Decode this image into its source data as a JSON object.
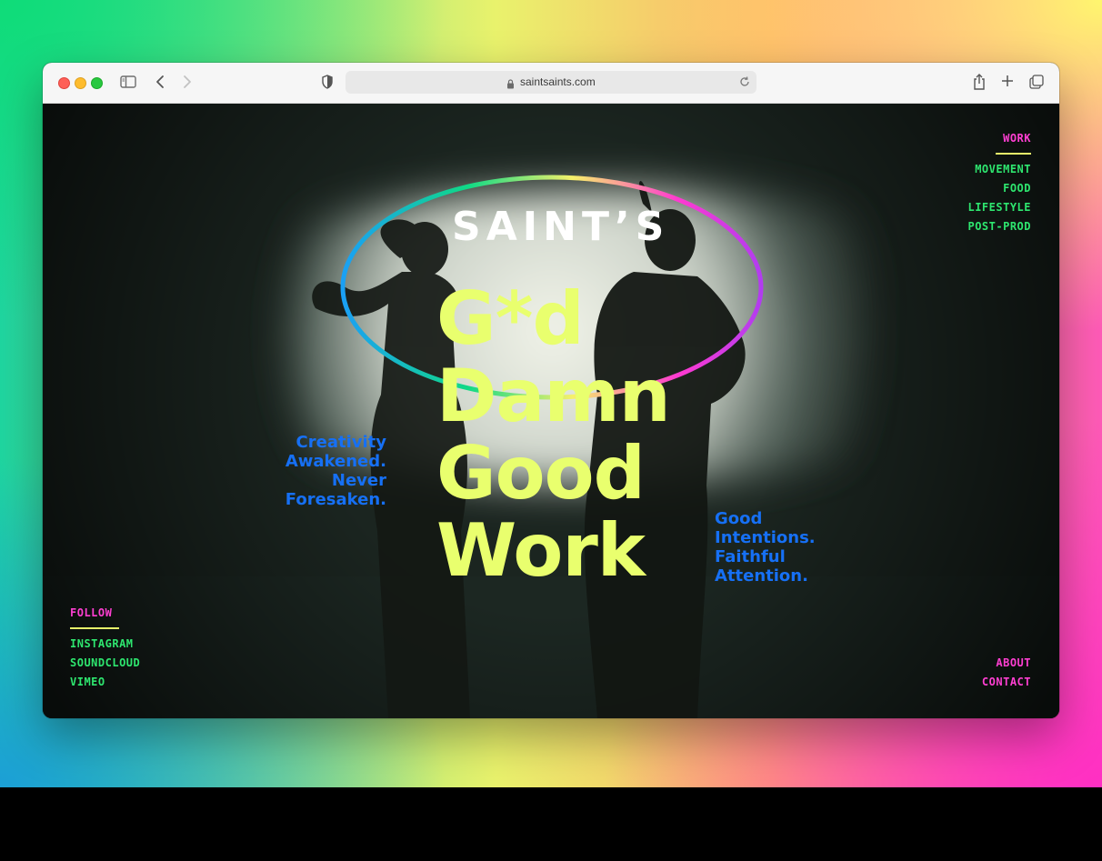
{
  "browser": {
    "url": "saintsaints.com",
    "icons": [
      "sidebar-icon",
      "back-icon",
      "forward-icon",
      "shield-icon",
      "lock-icon",
      "reload-icon",
      "share-icon",
      "new-tab-icon",
      "tabs-overview-icon"
    ]
  },
  "site": {
    "logo": "SAINT’S",
    "headline": [
      "G*d",
      "Damn",
      "Good",
      "Work"
    ],
    "tagline_left": [
      "Creativity",
      "Awakened.",
      "Never",
      "Foresaken."
    ],
    "tagline_right": [
      "Good",
      "Intentions.",
      "Faithful",
      "Attention."
    ],
    "work_nav": {
      "heading": "WORK",
      "items": [
        "MOVEMENT",
        "FOOD",
        "LIFESTYLE",
        "POST-PROD"
      ]
    },
    "follow_nav": {
      "heading": "FOLLOW",
      "items": [
        "INSTAGRAM",
        "SOUNDCLOUD",
        "VIMEO"
      ]
    },
    "footer_nav": {
      "items": [
        "ABOUT",
        "CONTACT"
      ]
    }
  },
  "colors": {
    "headline": "#e9ff6e",
    "tagline": "#1670f5",
    "nav_green": "#2ee66f",
    "nav_pink": "#ff3fd2",
    "rule": "#e6f56a"
  }
}
